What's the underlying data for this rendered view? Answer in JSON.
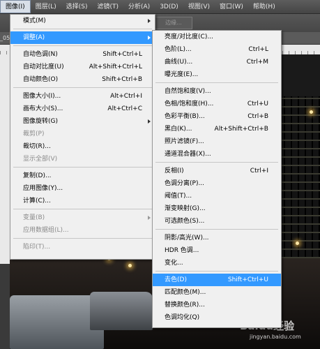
{
  "menubar": {
    "items": [
      "图像(I)",
      "图层(L)",
      "选择(S)",
      "滤镜(T)",
      "分析(A)",
      "3D(D)",
      "视图(V)",
      "窗口(W)",
      "帮助(H)"
    ],
    "active_index": 0
  },
  "options_bar": {
    "button_label": "边缘..."
  },
  "tab_text": "_05",
  "image_menu": {
    "items": [
      {
        "label": "模式(M)",
        "shortcut": "",
        "submenu": true
      },
      {
        "sep": true
      },
      {
        "label": "调整(A)",
        "shortcut": "",
        "submenu": true,
        "highlighted": true
      },
      {
        "sep": true
      },
      {
        "label": "自动色调(N)",
        "shortcut": "Shift+Ctrl+L"
      },
      {
        "label": "自动对比度(U)",
        "shortcut": "Alt+Shift+Ctrl+L"
      },
      {
        "label": "自动颜色(O)",
        "shortcut": "Shift+Ctrl+B"
      },
      {
        "sep": true
      },
      {
        "label": "图像大小(I)...",
        "shortcut": "Alt+Ctrl+I"
      },
      {
        "label": "画布大小(S)...",
        "shortcut": "Alt+Ctrl+C"
      },
      {
        "label": "图像旋转(G)",
        "shortcut": "",
        "submenu": true
      },
      {
        "label": "裁剪(P)",
        "shortcut": "",
        "disabled": true
      },
      {
        "label": "裁切(R)...",
        "shortcut": ""
      },
      {
        "label": "显示全部(V)",
        "shortcut": "",
        "disabled": true
      },
      {
        "sep": true
      },
      {
        "label": "复制(D)...",
        "shortcut": ""
      },
      {
        "label": "应用图像(Y)...",
        "shortcut": ""
      },
      {
        "label": "计算(C)...",
        "shortcut": ""
      },
      {
        "sep": true
      },
      {
        "label": "变量(B)",
        "shortcut": "",
        "submenu": true,
        "disabled": true
      },
      {
        "label": "应用数据组(L)...",
        "shortcut": "",
        "disabled": true
      },
      {
        "sep": true
      },
      {
        "label": "陷印(T)...",
        "shortcut": "",
        "disabled": true
      }
    ]
  },
  "adjust_menu": {
    "items": [
      {
        "label": "亮度/对比度(C)...",
        "shortcut": ""
      },
      {
        "label": "色阶(L)...",
        "shortcut": "Ctrl+L"
      },
      {
        "label": "曲线(U)...",
        "shortcut": "Ctrl+M"
      },
      {
        "label": "曝光度(E)...",
        "shortcut": ""
      },
      {
        "sep": true
      },
      {
        "label": "自然饱和度(V)...",
        "shortcut": ""
      },
      {
        "label": "色相/饱和度(H)...",
        "shortcut": "Ctrl+U"
      },
      {
        "label": "色彩平衡(B)...",
        "shortcut": "Ctrl+B"
      },
      {
        "label": "黑白(K)...",
        "shortcut": "Alt+Shift+Ctrl+B"
      },
      {
        "label": "照片滤镜(F)...",
        "shortcut": ""
      },
      {
        "label": "通道混合器(X)...",
        "shortcut": ""
      },
      {
        "sep": true
      },
      {
        "label": "反相(I)",
        "shortcut": "Ctrl+I"
      },
      {
        "label": "色调分离(P)...",
        "shortcut": ""
      },
      {
        "label": "阈值(T)...",
        "shortcut": ""
      },
      {
        "label": "渐变映射(G)...",
        "shortcut": ""
      },
      {
        "label": "可选颜色(S)...",
        "shortcut": ""
      },
      {
        "sep": true
      },
      {
        "label": "阴影/高光(W)...",
        "shortcut": ""
      },
      {
        "label": "HDR 色调...",
        "shortcut": ""
      },
      {
        "label": "变化...",
        "shortcut": ""
      },
      {
        "sep": true
      },
      {
        "label": "去色(D)",
        "shortcut": "Shift+Ctrl+U",
        "highlighted": true
      },
      {
        "label": "匹配颜色(M)...",
        "shortcut": ""
      },
      {
        "label": "替换颜色(R)...",
        "shortcut": ""
      },
      {
        "label": "色调均化(Q)",
        "shortcut": ""
      }
    ]
  },
  "watermark": {
    "logo": "Baidu经验",
    "url": "jingyan.baidu.com"
  },
  "colors": {
    "highlight": "#3399ff",
    "menu_bg": "#f0f0f0",
    "menubar_bg": "#4e4e4e"
  }
}
